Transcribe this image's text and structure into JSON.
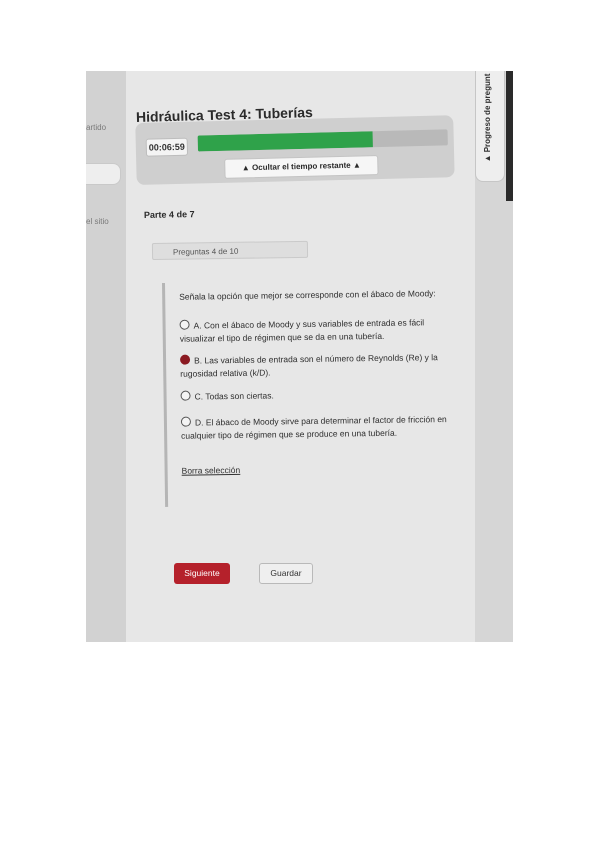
{
  "sidebar": {
    "fragment_top": "artido",
    "fragment_mid": "el sitio"
  },
  "header": {
    "title": "Hidráulica Test 4: Tuberías"
  },
  "timer": {
    "time_remaining": "00:06:59",
    "progress_fraction": 0.7,
    "progress_color": "#2fa24a",
    "hide_label": "▲ Ocultar el tiempo restante ▲"
  },
  "right_panel": {
    "label": "▲ Progreso de pregunt"
  },
  "part": {
    "label": "Parte 4 de 7"
  },
  "question": {
    "counter": "Preguntas 4 de 10",
    "text": "Señala la opción que mejor se corresponde con el ábaco de Moody:",
    "options": [
      {
        "label": "A. Con el ábaco de Moody y sus variables de entrada es fácil visualizar el tipo de régimen que se da en una tubería.",
        "selected": false
      },
      {
        "label": "B. Las variables de entrada son el número de Reynolds (Re) y la rugosidad relativa (k/D).",
        "selected": true
      },
      {
        "label": "C. Todas son ciertas.",
        "selected": false
      },
      {
        "label": "D. El ábaco de Moody sirve para determinar el factor de fricción en cualquier tipo de régimen que se produce en una tubería.",
        "selected": false
      }
    ],
    "clear_label": "Borra selección"
  },
  "actions": {
    "next_label": "Siguiente",
    "save_label": "Guardar",
    "next_color": "#b5212b"
  }
}
